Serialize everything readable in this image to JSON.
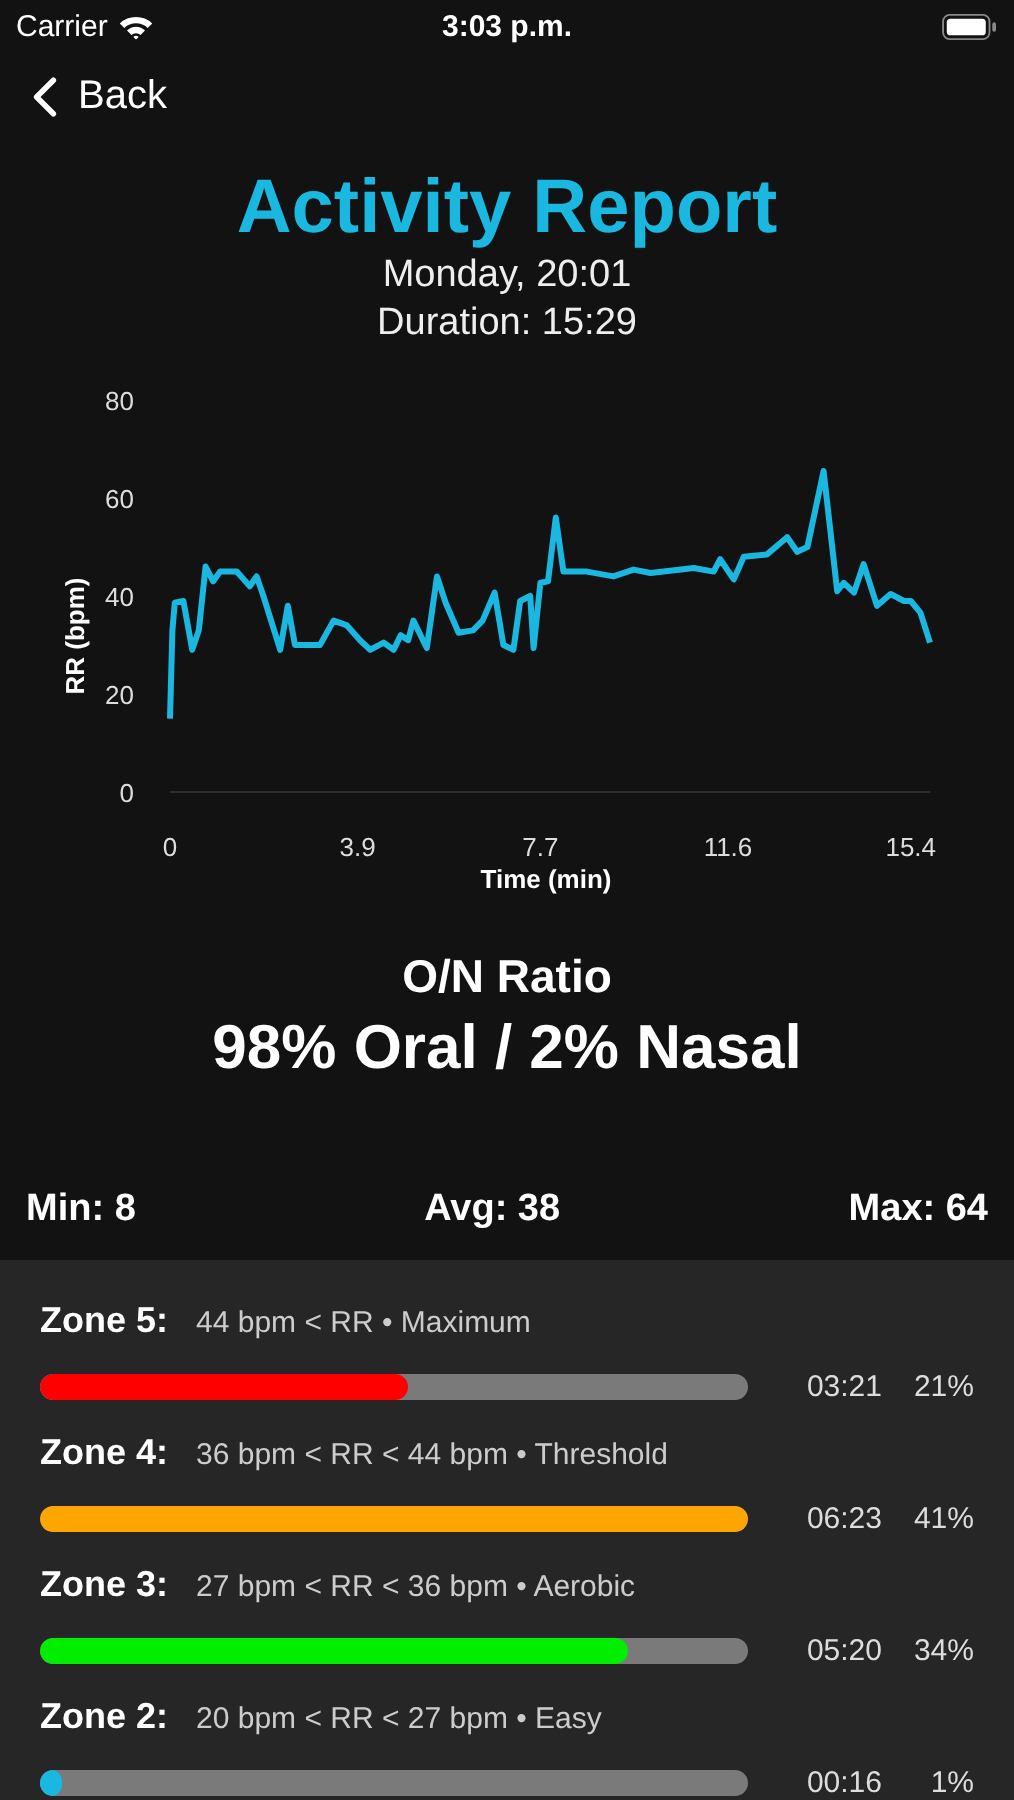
{
  "status_bar": {
    "carrier": "Carrier",
    "time": "3:03 p.m."
  },
  "nav": {
    "back": "Back"
  },
  "title": "Activity Report",
  "subtitle_lines": [
    "Monday, 20:01",
    "Duration: 15:29"
  ],
  "chart_data": {
    "type": "line",
    "xlabel": "Time (min)",
    "ylabel": "RR (bpm)",
    "xlim": [
      0,
      15.8
    ],
    "ylim": [
      0,
      80
    ],
    "xticks": [
      0,
      3.9,
      7.7,
      11.6,
      15.4
    ],
    "yticks": [
      0,
      20,
      40,
      60,
      80
    ],
    "x": [
      0,
      0.05,
      0.1,
      0.28,
      0.46,
      0.6,
      0.74,
      0.9,
      1.04,
      1.39,
      1.66,
      1.8,
      1.94,
      2.29,
      2.45,
      2.6,
      3.12,
      3.4,
      3.68,
      3.95,
      4.16,
      4.44,
      4.65,
      4.8,
      4.95,
      5.06,
      5.34,
      5.55,
      5.73,
      6.0,
      6.3,
      6.5,
      6.75,
      6.93,
      7.14,
      7.28,
      7.49,
      7.56,
      7.7,
      7.86,
      8.02,
      8.18,
      8.67,
      9.22,
      9.64,
      9.99,
      10.89,
      11.3,
      11.44,
      11.72,
      11.93,
      12.41,
      12.83,
      13.04,
      13.25,
      13.59,
      13.87,
      14.01,
      14.22,
      14.42,
      14.7,
      14.98,
      15.26,
      15.4,
      15.6,
      15.8
    ],
    "series": [
      {
        "color": "#1ab8e0",
        "values": [
          15,
          33,
          38.6,
          39,
          29,
          33,
          46,
          43,
          45,
          45,
          42,
          44,
          40,
          29,
          38,
          30,
          30,
          35,
          34,
          31,
          29,
          30.5,
          29,
          32,
          31,
          35,
          29.4,
          44,
          38.6,
          32.5,
          33,
          35,
          40.7,
          30,
          29,
          39,
          40,
          29.4,
          42.7,
          43,
          56,
          45,
          45,
          44,
          45.4,
          44.7,
          45.7,
          45,
          47.5,
          43.4,
          48,
          48.5,
          52,
          49,
          50,
          65.5,
          41,
          42.7,
          40.7,
          46.5,
          38,
          40.4,
          39,
          39,
          36.6,
          30.5
        ]
      }
    ]
  },
  "ratio": {
    "heading": "O/N Ratio",
    "value": "98% Oral / 2% Nasal"
  },
  "stats": [
    "Min: 8",
    "Avg: 38",
    "Max: 64"
  ],
  "zones": [
    {
      "label": "Zone 5:",
      "range": "44 bpm < RR • Maximum",
      "level": 0.52,
      "color": "#ff0000",
      "time": "03:21",
      "percent": "21%"
    },
    {
      "label": "Zone 4:",
      "range": "36 bpm < RR < 44 bpm • Threshold",
      "level": 1,
      "color": "#ffa500",
      "time": "06:23",
      "percent": "41%"
    },
    {
      "label": "Zone 3:",
      "range": "27 bpm < RR < 36 bpm • Aerobic",
      "level": 0.83,
      "color": "#00ee00",
      "time": "05:20",
      "percent": "34%"
    },
    {
      "label": "Zone 2:",
      "range": "20 bpm < RR < 27 bpm • Easy",
      "level": 0.03,
      "color": "#1ab8e0",
      "time": "00:16",
      "percent": "1%"
    }
  ]
}
